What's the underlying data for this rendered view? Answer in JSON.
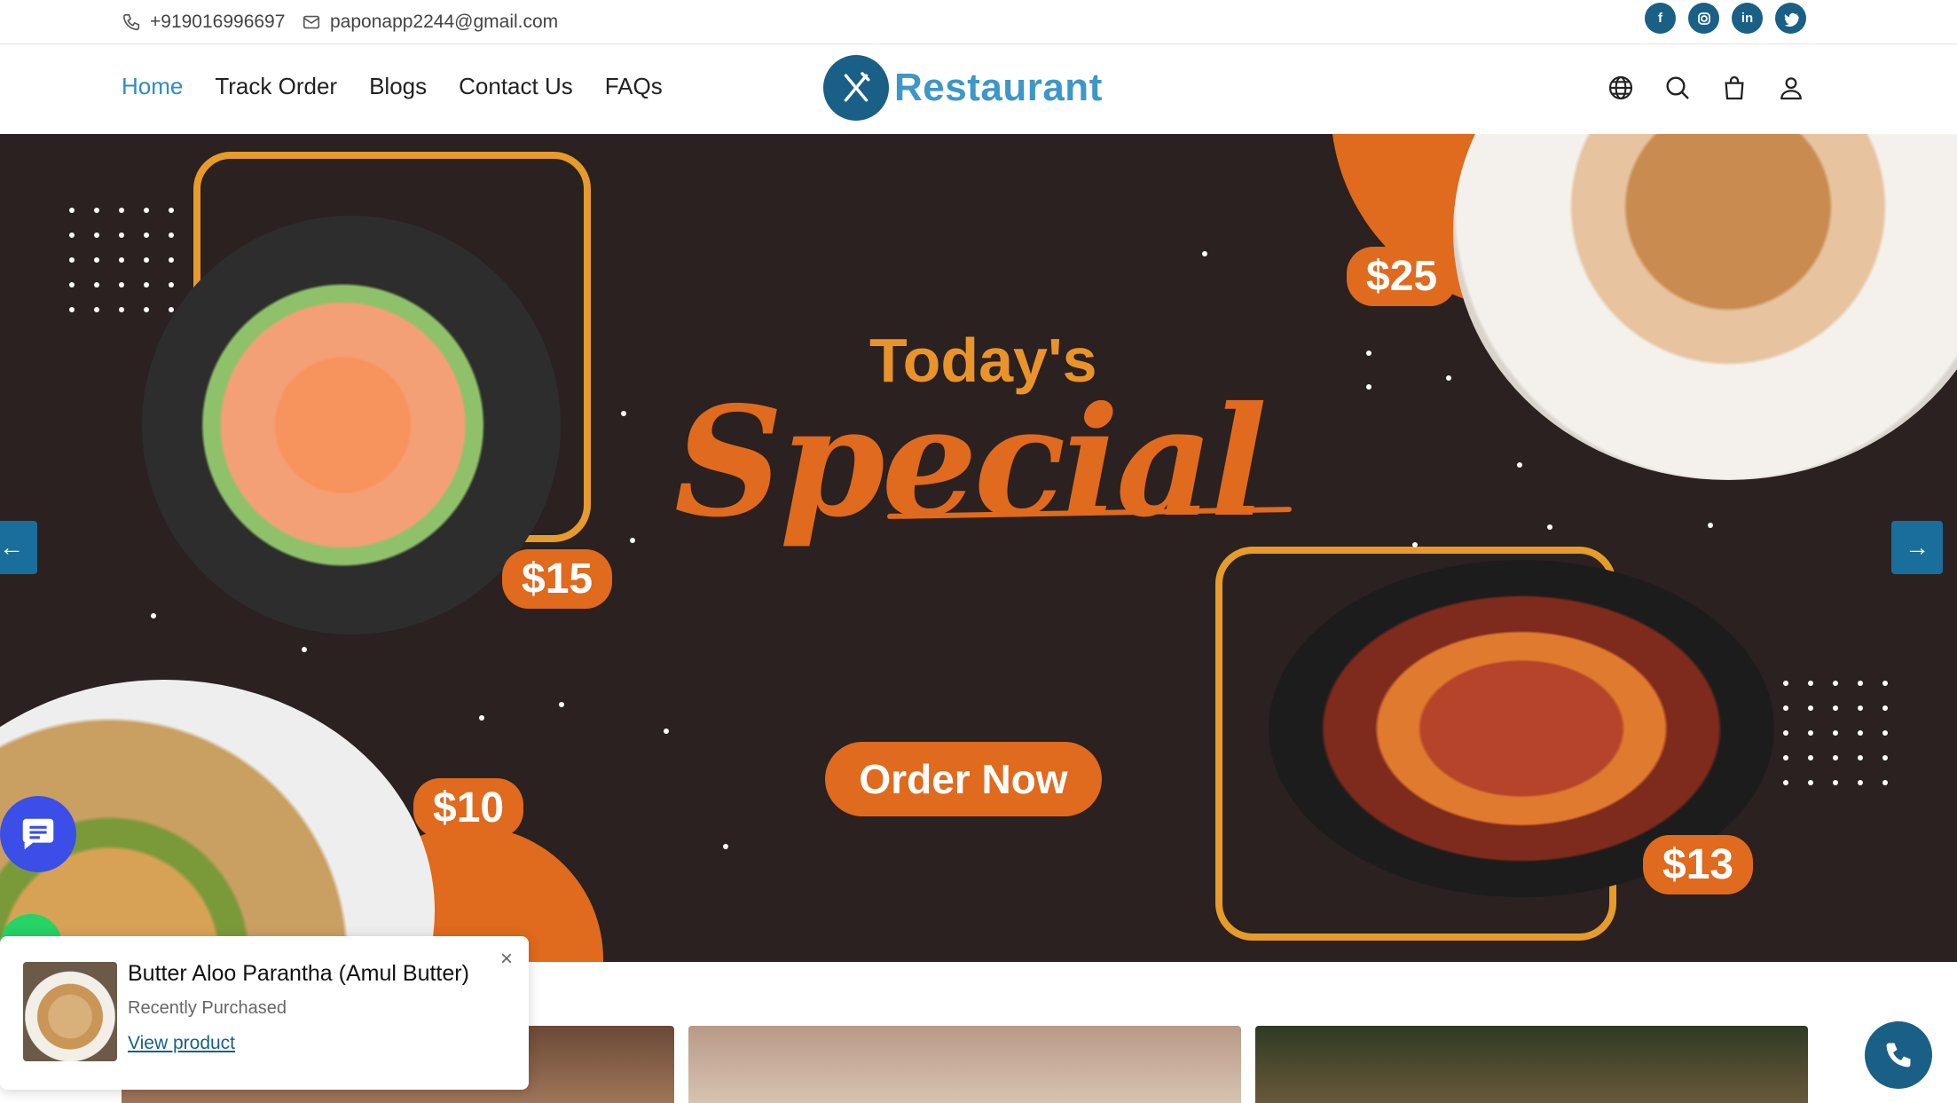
{
  "topbar": {
    "phone": "+919016996697",
    "email": "paponapp2244@gmail.com",
    "socials": [
      "facebook-icon",
      "instagram-icon",
      "linkedin-icon",
      "twitter-icon"
    ]
  },
  "nav": {
    "links": [
      "Home",
      "Track Order",
      "Blogs",
      "Contact Us",
      "FAQs"
    ],
    "active": "Home",
    "logo_text": "Restaurant",
    "icons": [
      "globe-icon",
      "search-icon",
      "bag-icon",
      "user-icon"
    ]
  },
  "hero": {
    "heading_top": "Today's",
    "heading_script": "Special",
    "cta": "Order Now",
    "prices": [
      "$15",
      "$25",
      "$10",
      "$13"
    ]
  },
  "popup": {
    "title": "Butter Aloo Parantha (Amul Butter)",
    "subtitle": "Recently Purchased",
    "link": "View product",
    "close": "×"
  },
  "colors": {
    "brand": "#1a5f85",
    "accent": "#e06a1d",
    "hero_bg": "#2a2120"
  }
}
